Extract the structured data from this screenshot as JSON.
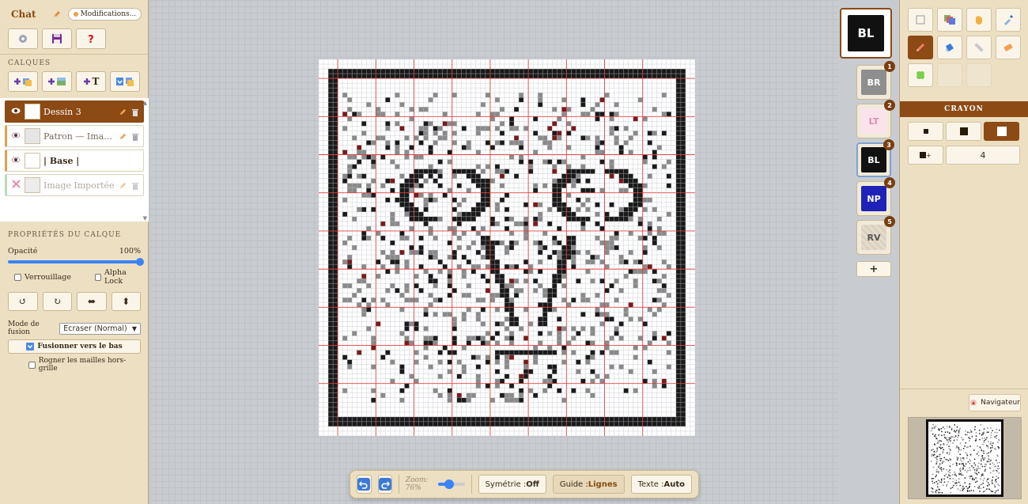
{
  "header": {
    "title": "Chat",
    "status_badge": "Modifications..."
  },
  "layers_section": {
    "label": "CALQUES",
    "add_text_label": "T"
  },
  "layers": [
    {
      "name": "Dessin 3",
      "active": true
    },
    {
      "name": "Patron — Imag...",
      "active": false
    },
    {
      "name": "| Base |",
      "active": false
    },
    {
      "name": "Image Importée",
      "active": false
    }
  ],
  "properties": {
    "label": "PROPRIÉTÉS DU CALQUE",
    "opacity_label": "Opacité",
    "opacity_value": "100%",
    "opacity": 1.0,
    "lock_label": "Verrouillage",
    "alpha_lock_label": "Alpha Lock",
    "blend_label": "Mode de fusion",
    "blend_value": "Ecraser (Normal)",
    "merge_label": "Fusionner vers le bas",
    "crop_label": "Rogner les mailles hors-grille"
  },
  "bottombar": {
    "zoom_label": "Zoom: 76%",
    "symmetry_label": "Symétrie :",
    "symmetry_value": "Off",
    "guide_label": "Guide :",
    "guide_value": "Lignes",
    "text_label": "Texte :",
    "text_value": "Auto"
  },
  "palette": {
    "current": {
      "code": "BL",
      "color": "#111111",
      "text_color": "#ffffff"
    },
    "colors": [
      {
        "num": "1",
        "code": "BR",
        "color": "#8e8e8e",
        "text_color": "#ffffff"
      },
      {
        "num": "2",
        "code": "LT",
        "color": "#fbe3ec",
        "text_color": "#e08ab0"
      },
      {
        "num": "3",
        "code": "BL",
        "color": "#111111",
        "text_color": "#ffffff"
      },
      {
        "num": "4",
        "code": "NP",
        "color": "#1f22b8",
        "text_color": "#ffffff"
      },
      {
        "num": "5",
        "code": "RV",
        "color": "#e6dccb",
        "text_color": "#555555"
      }
    ],
    "add_label": "+"
  },
  "tool_panel": {
    "tool_name": "CRAYON",
    "size_value": "4"
  },
  "navigator": {
    "label": "Navigateur"
  },
  "colors": {
    "accent": "#8c4a15",
    "panel": "#ecdfc2"
  }
}
